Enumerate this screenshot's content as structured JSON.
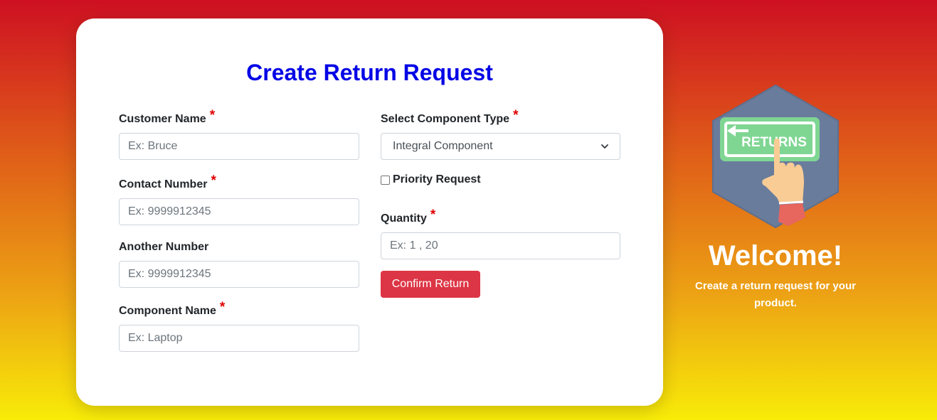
{
  "colors": {
    "accent": "#0505e6",
    "button": "#dc3545",
    "required": "#e00000"
  },
  "form": {
    "title": "Create Return Request",
    "required_mark": "*",
    "customer_name": {
      "label": "Customer Name",
      "placeholder": "Ex: Bruce",
      "value": ""
    },
    "contact_number": {
      "label": "Contact Number",
      "placeholder": "Ex: 9999912345",
      "value": ""
    },
    "another_number": {
      "label": "Another Number",
      "placeholder": "Ex: 9999912345",
      "value": ""
    },
    "component_name": {
      "label": "Component Name",
      "placeholder": "Ex: Laptop",
      "value": ""
    },
    "component_type": {
      "label": "Select Component Type",
      "selected": "Integral Component"
    },
    "priority": {
      "label": "Priority Request",
      "checked": false
    },
    "quantity": {
      "label": "Quantity",
      "placeholder": "Ex: 1 , 20",
      "value": ""
    },
    "submit_label": "Confirm Return"
  },
  "sidebar": {
    "image_text": "RETURNS",
    "image_icon": "returns-sign-icon",
    "heading": "Welcome!",
    "tagline": "Create a return request for your product."
  }
}
